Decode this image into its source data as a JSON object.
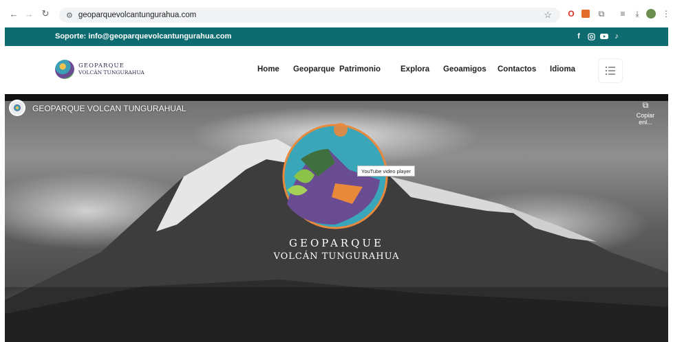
{
  "browser": {
    "url": "geoparquevolcantungurahua.com"
  },
  "support_bar": {
    "email_label": "Soporte: info@geoparquevolcantungurahua.com",
    "social_icons": [
      "facebook-icon",
      "instagram-icon",
      "youtube-icon",
      "tiktok-icon"
    ]
  },
  "header": {
    "logo_line1": "GEOPARQUE",
    "logo_line2": "VOLCÁN TUNGURAHUA",
    "menu": [
      {
        "label": "Home"
      },
      {
        "label": "Geoparque"
      },
      {
        "label": "Patrimonio"
      },
      {
        "label": "Explora"
      },
      {
        "label": "Geoamigos"
      },
      {
        "label": "Contactos"
      },
      {
        "label": "Idioma"
      }
    ]
  },
  "video": {
    "title": "GEOPARQUE VOLCAN TUNGURAHUAL",
    "copy_label": "Copiar enl...",
    "tooltip": "YouTube video player",
    "brand_line1": "GEOPARQUE",
    "brand_line2": "VOLCÁN TUNGURAHUA"
  },
  "colors": {
    "support_bar": "#0e6b6f",
    "accent_orange": "#e8893c"
  }
}
